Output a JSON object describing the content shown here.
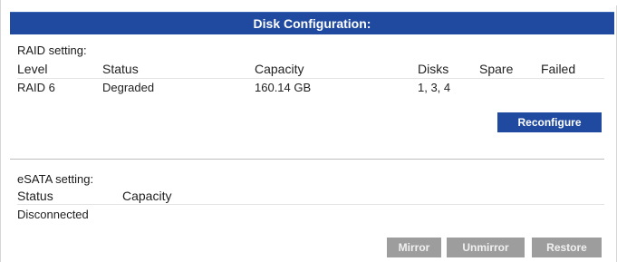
{
  "header": {
    "title": "Disk Configuration:"
  },
  "raid": {
    "section_label": "RAID setting:",
    "columns": [
      "Level",
      "Status",
      "Capacity",
      "Disks",
      "Spare",
      "Failed"
    ],
    "rows": [
      {
        "level": "RAID 6",
        "status": "Degraded",
        "capacity": "160.14 GB",
        "disks": "1, 3, 4",
        "spare": "",
        "failed": ""
      }
    ],
    "reconfigure_label": "Reconfigure"
  },
  "esata": {
    "section_label": "eSATA setting:",
    "columns": [
      "Status",
      "Capacity"
    ],
    "rows": [
      {
        "status": "Disconnected",
        "capacity": ""
      }
    ],
    "buttons": {
      "mirror": "Mirror",
      "unmirror": "Unmirror",
      "restore": "Restore"
    }
  },
  "colors": {
    "accent": "#1f4aa0",
    "disabled_button": "#9d9d9d"
  }
}
